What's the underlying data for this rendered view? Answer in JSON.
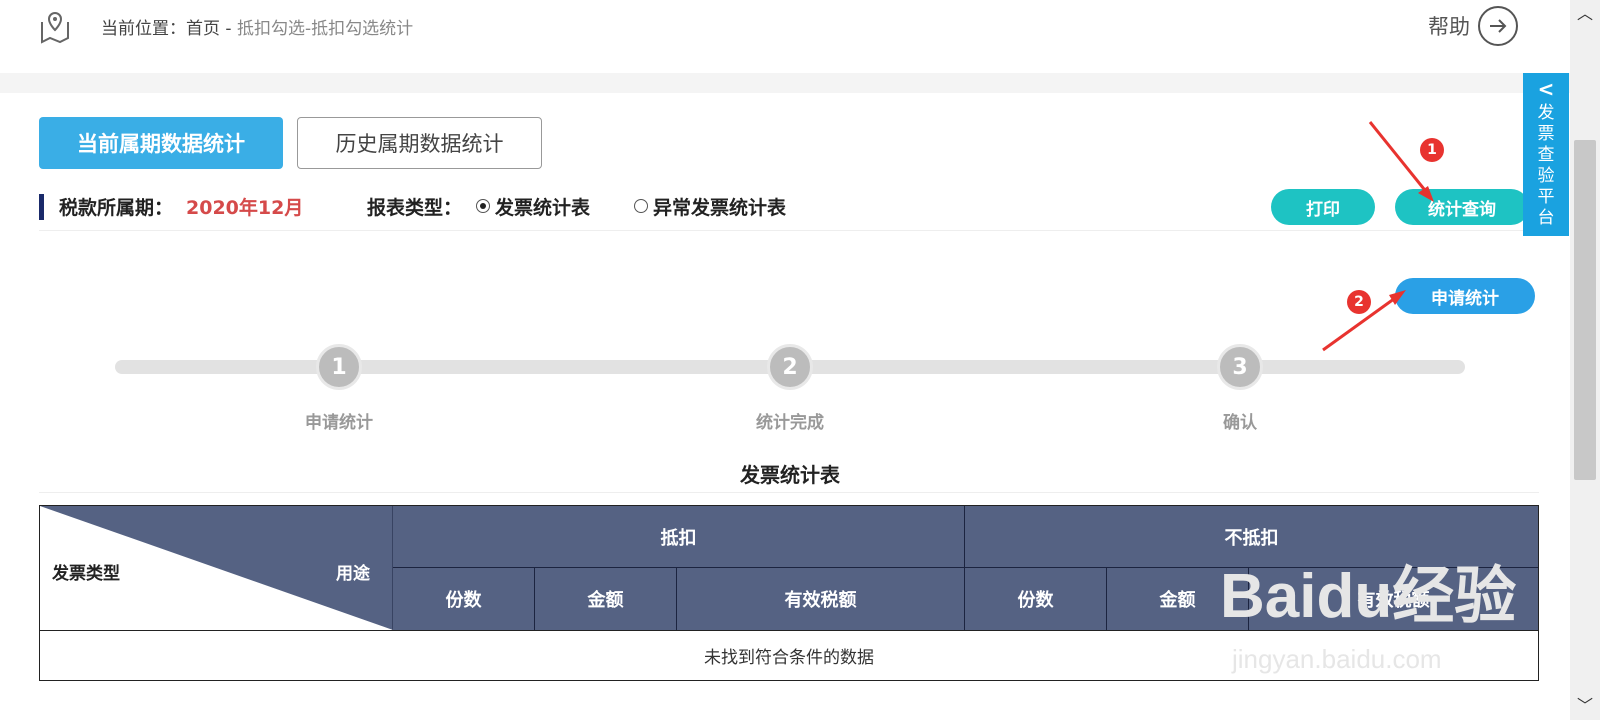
{
  "breadcrumb": {
    "prefix": "当前位置：首页 - ",
    "path": "抵扣勾选-抵扣勾选统计"
  },
  "help": {
    "label": "帮助"
  },
  "tabs": [
    {
      "label": "当前属期数据统计",
      "active": true
    },
    {
      "label": "历史属期数据统计",
      "active": false
    }
  ],
  "filter": {
    "period_label": "税款所属期：",
    "period_value": "2020年12月",
    "type_label": "报表类型：",
    "options": [
      {
        "label": "发票统计表",
        "selected": true
      },
      {
        "label": "异常发票统计表",
        "selected": false
      }
    ]
  },
  "buttons": {
    "print": "打印",
    "query": "统计查询",
    "apply": "申请统计"
  },
  "annotations": {
    "badge1": "1",
    "badge2": "2"
  },
  "side_panel": {
    "chevron": "<",
    "text": "发票查验平台"
  },
  "steps": [
    {
      "num": "1",
      "label": "申请统计"
    },
    {
      "num": "2",
      "label": "统计完成"
    },
    {
      "num": "3",
      "label": "确认"
    }
  ],
  "table": {
    "title": "发票统计表",
    "corner_left": "发票类型",
    "corner_right": "用途",
    "groups": [
      "抵扣",
      "不抵扣"
    ],
    "columns": [
      "份数",
      "金额",
      "有效税额",
      "份数",
      "金额",
      "有效税额"
    ],
    "empty": "未找到符合条件的数据"
  },
  "watermark": {
    "main": "Baidu经验",
    "sub": "jingyan.baidu.com"
  },
  "colors": {
    "accent": "#3aaee6",
    "teal": "#1ec3c3",
    "header": "#556283",
    "period": "#d54a4a",
    "annotation": "#e8332f"
  }
}
